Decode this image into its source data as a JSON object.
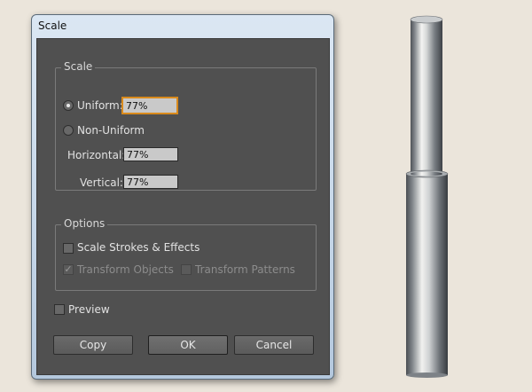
{
  "dialog": {
    "title": "Scale",
    "scale_group": {
      "legend": "Scale",
      "uniform_label": "Uniform:",
      "uniform_value": "77%",
      "uniform_selected": true,
      "non_uniform_label": "Non-Uniform",
      "horizontal_label": "Horizontal:",
      "horizontal_value": "77%",
      "vertical_label": "Vertical:",
      "vertical_value": "77%"
    },
    "options_group": {
      "legend": "Options",
      "scale_strokes_label": "Scale Strokes & Effects",
      "scale_strokes_checked": false,
      "transform_objects_label": "Transform Objects",
      "transform_objects_checked": true,
      "transform_patterns_label": "Transform Patterns",
      "transform_patterns_checked": false
    },
    "preview_label": "Preview",
    "preview_checked": false,
    "buttons": {
      "copy": "Copy",
      "ok": "OK",
      "cancel": "Cancel"
    }
  },
  "colors": {
    "dialog_bg": "#505050",
    "focus_border": "#d98a1c",
    "canvas_bg": "#ebe5db"
  }
}
